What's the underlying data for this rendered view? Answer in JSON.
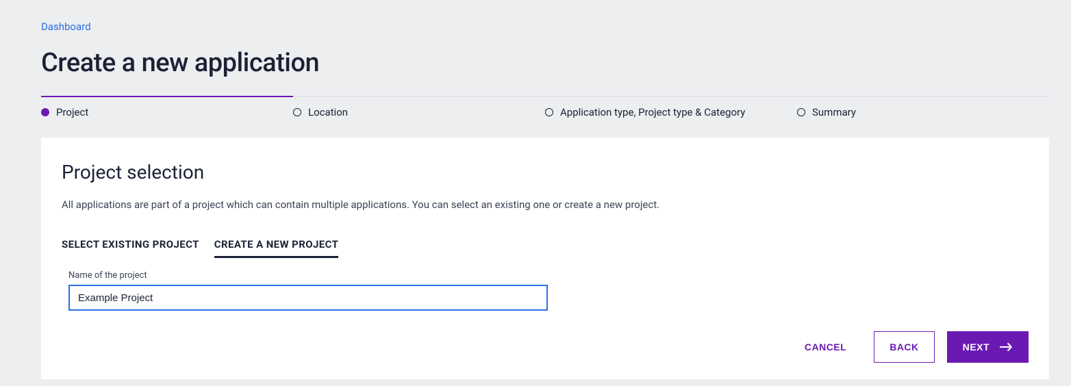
{
  "breadcrumb": {
    "dashboard": "Dashboard"
  },
  "page_title": "Create a new application",
  "stepper": {
    "steps": [
      {
        "label": "Project",
        "active": true
      },
      {
        "label": "Location",
        "active": false
      },
      {
        "label": "Application type, Project type & Category",
        "active": false
      },
      {
        "label": "Summary",
        "active": false
      }
    ]
  },
  "section": {
    "title": "Project selection",
    "description": "All applications are part of a project which can contain multiple applications. You can select an existing one or create a new project."
  },
  "tabs": {
    "select_existing": "SELECT EXISTING PROJECT",
    "create_new": "CREATE A NEW PROJECT"
  },
  "form": {
    "project_name_label": "Name of the project",
    "project_name_value": "Example Project"
  },
  "actions": {
    "cancel": "CANCEL",
    "back": "BACK",
    "next": "NEXT"
  }
}
